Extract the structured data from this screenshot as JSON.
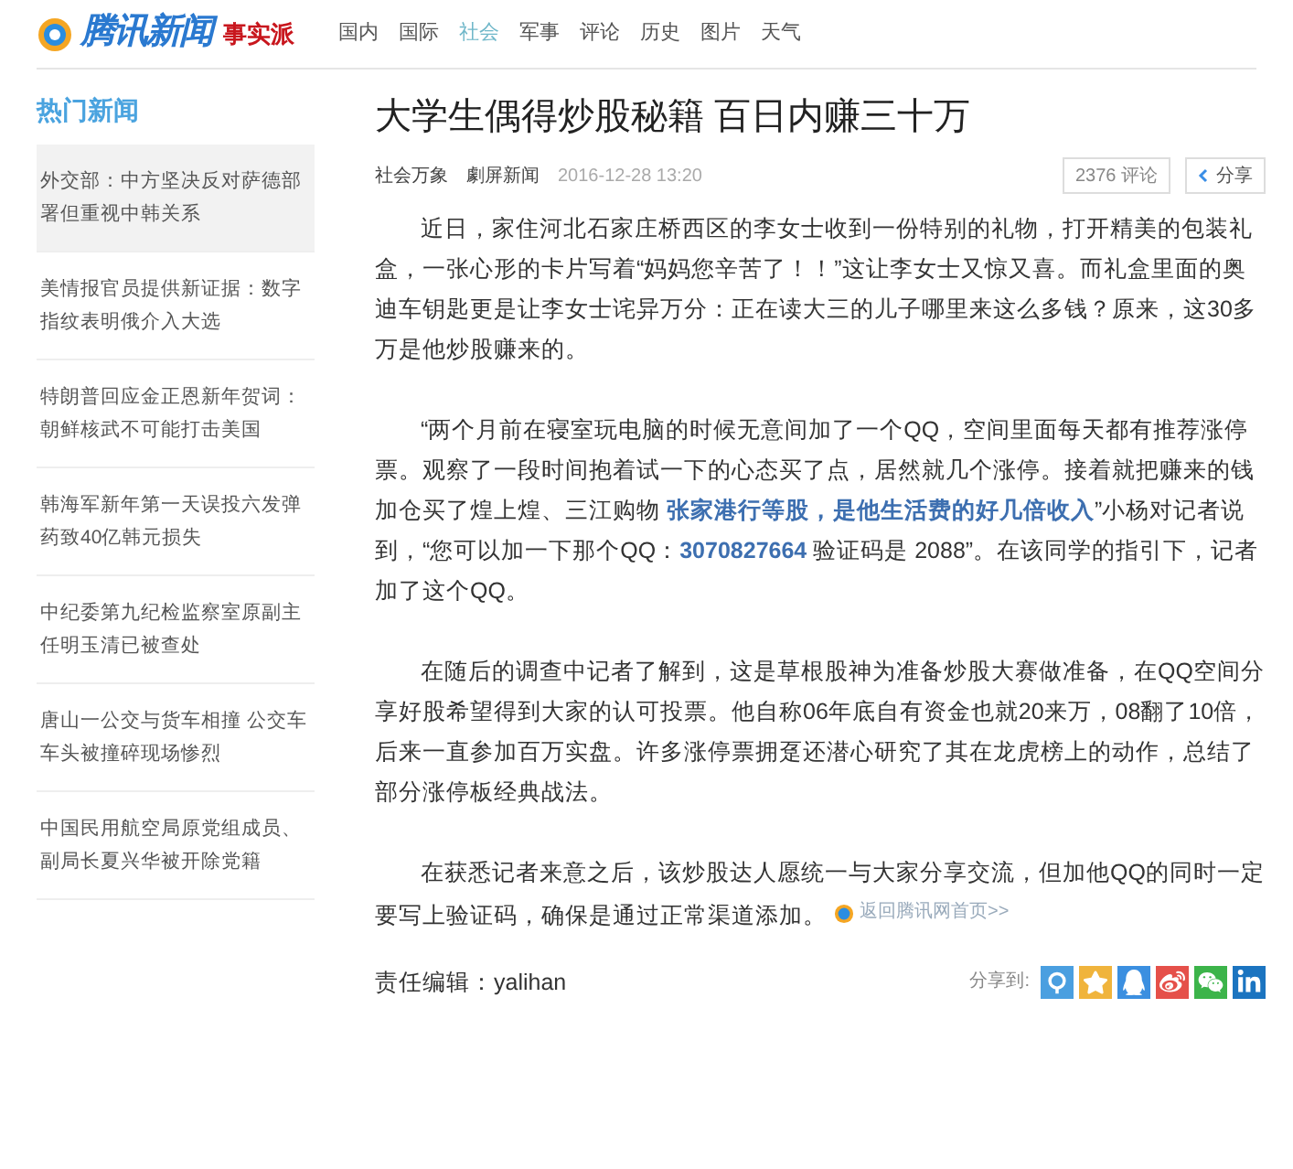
{
  "header": {
    "logo_text": "腾讯新闻",
    "logo_badge": "事实派",
    "nav": [
      {
        "label": "国内",
        "selected": false
      },
      {
        "label": "国际",
        "selected": false
      },
      {
        "label": "社会",
        "selected": true
      },
      {
        "label": "军事",
        "selected": false
      },
      {
        "label": "评论",
        "selected": false
      },
      {
        "label": "历史",
        "selected": false
      },
      {
        "label": "图片",
        "selected": false
      },
      {
        "label": "天气",
        "selected": false
      }
    ]
  },
  "sidebar": {
    "title": "热门新闻",
    "items": [
      {
        "label": "外交部：中方坚决反对萨德部署但重视中韩关系",
        "selected": true
      },
      {
        "label": "美情报官员提供新证据：数字指纹表明俄介入大选",
        "selected": false
      },
      {
        "label": "特朗普回应金正恩新年贺词：朝鲜核武不可能打击美国",
        "selected": false
      },
      {
        "label": "韩海军新年第一天误投六发弹药致40亿韩元损失",
        "selected": false
      },
      {
        "label": "中纪委第九纪检监察室原副主任明玉清已被查处",
        "selected": false
      },
      {
        "label": "唐山一公交与货车相撞 公交车车头被撞碎现场惨烈",
        "selected": false
      },
      {
        "label": "中国民用航空局原党组成员、副局长夏兴华被开除党籍",
        "selected": false
      }
    ]
  },
  "article": {
    "title": "大学生偶得炒股秘籍 百日内赚三十万",
    "meta": [
      "社会万象",
      "劇屏新闻",
      "2016-12-28 13:20"
    ],
    "comments_button": "2376 评论",
    "share_button": "分享",
    "paragraphs": [
      "近日，家住河北石家庄桥西区的李女士收到一份特别的礼物，打开精美的包装礼盒，一张心形的卡片写着“妈妈您辛苦了！！”这让李女士又惊又喜。而礼盒里面的奥迪车钥匙更是让李女士诧异万分：正在读大三的儿子哪里来这么多钱？原来，这30多万是他炒股赚来的。",
      "“两个月前在寝室玩电脑的时候无意间加了一个QQ，空间里面每天都有推荐涨停票。观察了一段时间抱着试一下的心态买了点，居然就几个涨停。接着就把赚来的钱加仓买了煌上煌、三江购物 **张家港行等股，是他生活费的好几倍收入**”小杨对记者说到，“您可以加一下那个QQ：**3070827664** 验证码是 2088”。在该同学的指引下，记者加了这个QQ。",
      "在随后的调查中记者了解到，这是草根股神为准备炒股大赛做准备，在QQ空间分享好股希望得到大家的认可投票。他自称06年底自有资金也就20来万，08翻了10倍，后来一直参加百万实盘。许多涨停票拥趸还潜心研究了其在龙虎榜上的动作，总结了部分涨停板经典战法。",
      "在获悉记者来意之后，该炒股达人愿统一与大家分享交流，但加他QQ的同时一定要写上验证码，确保是通过正常渠道添加。"
    ],
    "return_link": "返回腾讯网首页>>",
    "editor": "责任编辑：yalihan",
    "share_label": "分享到:",
    "share_targets": [
      {
        "kind": "qzone",
        "color": "#4a9fe0"
      },
      {
        "kind": "star",
        "color": "#f0b43c"
      },
      {
        "kind": "qq",
        "color": "#3b8fe0"
      },
      {
        "kind": "weibo",
        "color": "#e5504a"
      },
      {
        "kind": "wechat",
        "color": "#3cb44a"
      },
      {
        "kind": "linkedin",
        "color": "#1b74c0"
      }
    ]
  }
}
